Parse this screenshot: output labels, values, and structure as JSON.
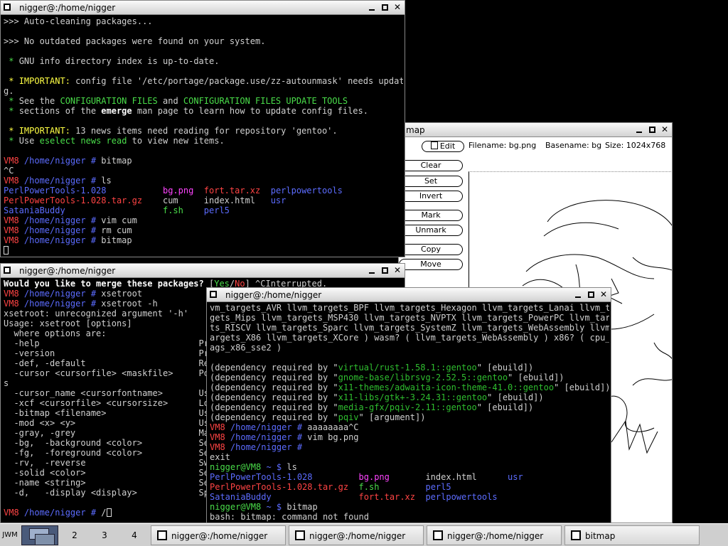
{
  "windows": {
    "term1": {
      "title": "nigger@:/home/nigger",
      "lines": [
        ">>> Auto-cleaning packages...",
        "",
        ">>> No outdated packages were found on your system.",
        "",
        {
          "a": " * ",
          "a_cls": "g",
          "b": "GNU info directory index is up-to-date."
        },
        "",
        {
          "a": " * ",
          "a_cls": "y",
          "b": "IMPORTANT:",
          "b_cls": "y",
          "c": " config file '/etc/portage/package.use/zz-autounmask' needs updatin"
        },
        "g.",
        {
          "a": " * ",
          "a_cls": "g",
          "b": "See the ",
          "c": "CONFIGURATION FILES",
          "c_cls": "g",
          "d": " and ",
          "e": "CONFIGURATION FILES UPDATE TOOLS",
          "e_cls": "g"
        },
        {
          "a": " * ",
          "a_cls": "g",
          "b": "sections of the ",
          "c": "emerge",
          "c_cls": "w",
          "d": " man page to learn how to update config files."
        },
        "",
        {
          "a": " * ",
          "a_cls": "y",
          "b": "IMPORTANT:",
          "b_cls": "y",
          "c": " 13 news items need reading for repository 'gentoo'."
        },
        {
          "a": " * ",
          "a_cls": "g",
          "b": "Use ",
          "c": "eselect news read",
          "c_cls": "g",
          "d": " to view new items."
        },
        "",
        {
          "a": "VM8 ",
          "a_cls": "r",
          "b": "/home/nigger # ",
          "b_cls": "b",
          "c": "bitmap"
        },
        "^C",
        {
          "a": "VM8 ",
          "a_cls": "r",
          "b": "/home/nigger # ",
          "b_cls": "b",
          "c": "ls"
        },
        {
          "a": "PerlPowerTools-1.028           ",
          "a_cls": "b",
          "b": "bg.png",
          "b_cls": "m",
          "c": "  ",
          "d": "fort.tar.xz",
          "d_cls": "r",
          "e": "  ",
          "f": "perlpowertools",
          "f_cls": "b"
        },
        {
          "a": "PerlPowerTools-1.028.tar.gz",
          "a_cls": "r",
          "b": "    cum     index.html   ",
          "c": "usr",
          "c_cls": "b"
        },
        {
          "a": "SataniaBuddy                   ",
          "a_cls": "b",
          "b": "f.sh",
          "b_cls": "g",
          "c": "    ",
          "d": "perl5",
          "d_cls": "b"
        },
        {
          "a": "VM8 ",
          "a_cls": "r",
          "b": "/home/nigger # ",
          "b_cls": "b",
          "c": "vim cum"
        },
        {
          "a": "VM8 ",
          "a_cls": "r",
          "b": "/home/nigger # ",
          "b_cls": "b",
          "c": "rm cum"
        },
        {
          "a": "VM8 ",
          "a_cls": "r",
          "b": "/home/nigger # ",
          "b_cls": "b",
          "c": "bitmap"
        },
        {
          "cursor": true
        }
      ]
    },
    "term2": {
      "title": "nigger@:/home/nigger",
      "lines": [
        {
          "a": "Would you like to merge these packages? ",
          "a_cls": "w",
          "b": "[",
          "c": "Yes",
          "c_cls": "g",
          "d": "/",
          "e": "No",
          "e_cls": "r",
          "f": "] ^CInterrupted."
        },
        {
          "a": "VM8 ",
          "a_cls": "r",
          "b": "/home/nigger # ",
          "b_cls": "b",
          "c": "xsetroot"
        },
        {
          "a": "VM8 ",
          "a_cls": "r",
          "b": "/home/nigger # ",
          "b_cls": "b",
          "c": "xsetroot -h"
        },
        "xsetroot: unrecognized argument '-h'",
        "Usage: xsetroot [options]",
        "  where options are:",
        "  -help                               Print t",
        "  -version                            Print a",
        "  -def, -default                      Reset u",
        "  -cursor <cursorfile> <maskfile>     Pointer",
        "s",
        "  -cursor_name <cursorfontname>       Use a p",
        "  -xcf <cursorfile> <cursorsize>      Load a",
        "  -bitmap <filename>                  Use the",
        "  -mod <x> <y>                        Use a p",
        "  -gray, -grey                        Make th",
        "  -bg,  -background <color>           Set bac",
        "  -fg,  -foreground <color>           Set for",
        "  -rv,  -reverse                      Swap fo",
        "  -solid <color>                      Set the",
        "  -name <string>                      Set the",
        "  -d,   -display <display>            Specifi",
        "",
        {
          "a": "VM8 ",
          "a_cls": "r",
          "b": "/home/nigger # ",
          "b_cls": "b",
          "c": "/",
          "cursor": true
        }
      ]
    },
    "term3": {
      "title": "nigger@:/home/nigger",
      "lines": [
        "vm_targets_AVR llvm_targets_BPF llvm_targets_Hexagon llvm_targets_Lanai llvm_tar",
        "gets_Mips llvm_targets_MSP430 llvm_targets_NVPTX llvm_targets_PowerPC llvm_targe",
        "ts_RISCV llvm_targets_Sparc llvm_targets_SystemZ llvm_targets_WebAssembly llvm_t",
        "argets_X86 llvm_targets_XCore ) wasm? ( llvm_targets_WebAssembly ) x86? ( cpu_fl",
        "ags_x86_sse2 )",
        "",
        {
          "a": "(dependency required by \"",
          "b": "virtual/rust-1.58.1::gentoo",
          "b_cls": "dgreen",
          "c": "\" [ebuild])"
        },
        {
          "a": "(dependency required by \"",
          "b": "gnome-base/librsvg-2.52.5::gentoo",
          "b_cls": "dgreen",
          "c": "\" [ebuild])"
        },
        {
          "a": "(dependency required by \"",
          "b": "x11-themes/adwaita-icon-theme-41.0::gentoo",
          "b_cls": "dgreen",
          "c": "\" [ebuild])"
        },
        {
          "a": "(dependency required by \"",
          "b": "x11-libs/gtk+-3.24.31::gentoo",
          "b_cls": "dgreen",
          "c": "\" [ebuild])"
        },
        {
          "a": "(dependency required by \"",
          "b": "media-gfx/pqiv-2.11::gentoo",
          "b_cls": "dgreen",
          "c": "\" [ebuild])"
        },
        {
          "a": "(dependency required by \"",
          "b": "pqiv",
          "b_cls": "dgreen",
          "c": "\" [argument])"
        },
        {
          "a": "VM8 ",
          "a_cls": "r",
          "b": "/home/nigger # ",
          "b_cls": "b",
          "c": "aaaaaaaa^C"
        },
        {
          "a": "VM8 ",
          "a_cls": "r",
          "b": "/home/nigger # ",
          "b_cls": "b",
          "c": "vim bg.png"
        },
        {
          "a": "VM8 ",
          "a_cls": "r",
          "b": "/home/nigger # ",
          "b_cls": "b"
        },
        "exit",
        {
          "a": "nigger@VM8 ",
          "a_cls": "g",
          "b": "~ $ ",
          "b_cls": "b",
          "c": "ls"
        },
        {
          "a": "PerlPowerTools-1.028         ",
          "a_cls": "b",
          "b": "bg.png",
          "b_cls": "m",
          "c": "       index.html      ",
          "d": "usr",
          "d_cls": "b"
        },
        {
          "a": "PerlPowerTools-1.028.tar.gz",
          "a_cls": "r",
          "b": "  ",
          "c": "f.sh",
          "c_cls": "g",
          "d": "         ",
          "e": "perl5",
          "e_cls": "b"
        },
        {
          "a": "SataniaBuddy                 ",
          "a_cls": "b",
          "b": "fort.tar.xz",
          "b_cls": "r",
          "c": "  ",
          "d": "perlpowertools",
          "d_cls": "b"
        },
        {
          "a": "nigger@VM8 ",
          "a_cls": "g",
          "b": "~ $ ",
          "b_cls": "b",
          "c": "bitmap"
        },
        "bash: bitmap: command not found"
      ]
    },
    "bitmap": {
      "title": "map",
      "edit_label": "Edit",
      "filename": "Filename: bg.png",
      "basename": "Basename: bg",
      "size": "Size: 1024x768",
      "buttons": [
        "Clear",
        "Set",
        "Invert",
        "Mark",
        "Unmark",
        "Copy",
        "Move"
      ]
    }
  },
  "taskbar": {
    "start_label": "JWM",
    "desktops": [
      "2",
      "3",
      "4"
    ],
    "tasks": [
      "nigger@:/home/nigger",
      "nigger@:/home/nigger",
      "nigger@:/home/nigger",
      "bitmap"
    ]
  },
  "colors": {
    "titlebar": "#e0e0e0",
    "prompt_red": "#ff4444",
    "prompt_blue": "#5c6cff",
    "green": "#4ade4a"
  }
}
